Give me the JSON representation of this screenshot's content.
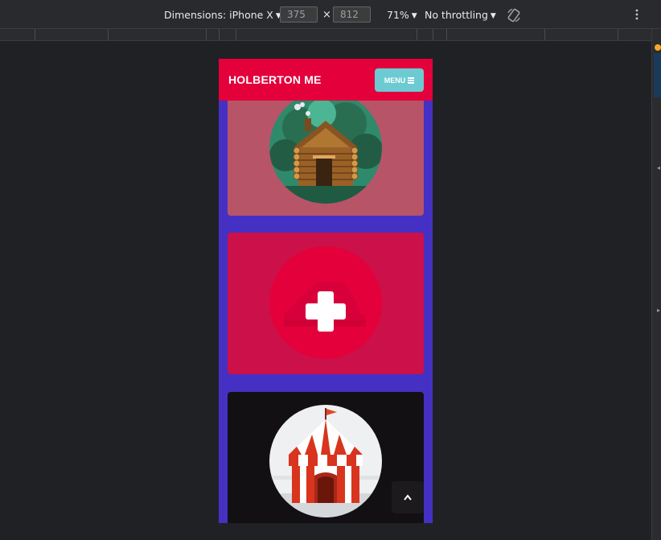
{
  "devtools": {
    "dimensions_label": "Dimensions: iPhone X",
    "width_value": "375",
    "height_value": "812",
    "times_symbol": "×",
    "zoom": "71%",
    "throttling": "No throttling"
  },
  "app": {
    "title": "HOLBERTON ME",
    "menu_label": "MENU",
    "cards": [
      {
        "illustration": "log-cabin-icon",
        "bg": "#b85468"
      },
      {
        "illustration": "add-plus-icon",
        "bg": "#cc1049"
      },
      {
        "illustration": "circus-tent-icon",
        "bg": "#131013"
      }
    ],
    "scroll_top_icon": "chevron-up-icon"
  },
  "colors": {
    "header": "#e3003b",
    "menu_button": "#6ccad3",
    "viewport_bg": "#4530c4",
    "devtools_bg": "#202124"
  }
}
